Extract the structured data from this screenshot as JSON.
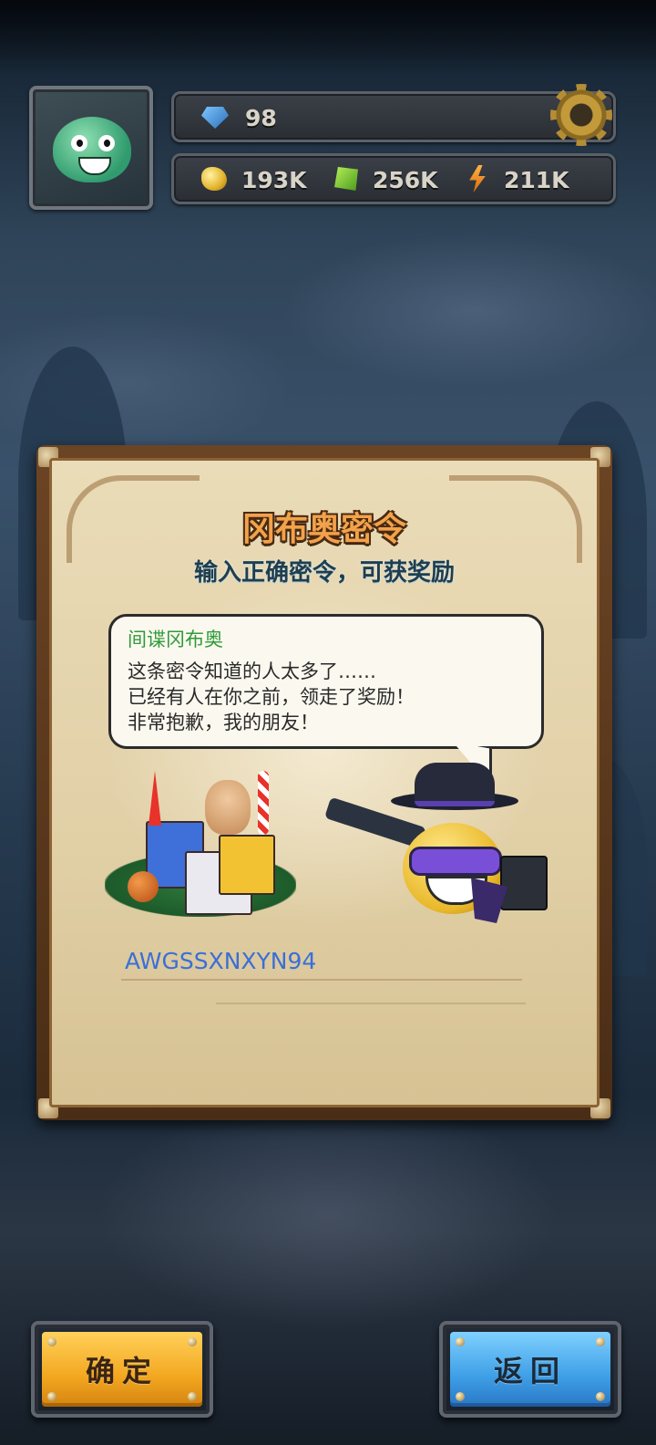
{
  "hud": {
    "gems": "98",
    "gold": "193K",
    "ore": "256K",
    "energy": "211K"
  },
  "icons": {
    "avatar": "green-monster-avatar",
    "gems": "blue-gem-icon",
    "gold": "gold-nugget-icon",
    "ore": "green-ore-icon",
    "energy": "lightning-bolt-icon",
    "settings": "gear-icon"
  },
  "dialog": {
    "title": "冈布奥密令",
    "subtitle": "输入正确密令，可获奖励",
    "speaker": "间谍冈布奥",
    "message_lines": [
      "这条密令知道的人太多了……",
      "已经有人在你之前，领走了奖励！",
      "非常抱歉，我的朋友！"
    ],
    "code_value": "AWGSSXNXYN94"
  },
  "buttons": {
    "confirm": "确定",
    "back": "返回"
  },
  "colors": {
    "title": "#f2a24a",
    "speaker": "#2f9b3a",
    "code": "#3a6fd8",
    "confirm_button": "#f3a720",
    "back_button": "#3e9fe6"
  }
}
